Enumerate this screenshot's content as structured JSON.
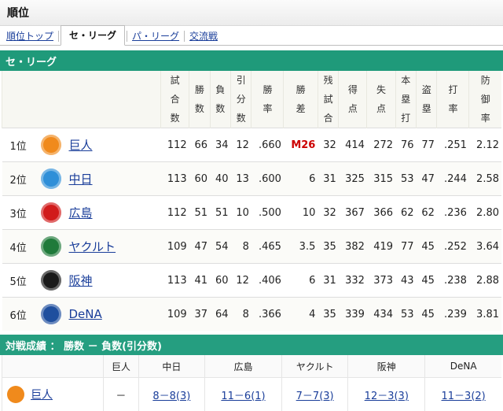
{
  "page_title": "順位",
  "tabs": [
    "順位トップ",
    "セ・リーグ",
    "パ・リーグ",
    "交流戦"
  ],
  "section_title": "セ・リーグ",
  "columns": [
    "試合数",
    "勝数",
    "負数",
    "引分数",
    "勝率",
    "勝差",
    "残試合",
    "得点",
    "失点",
    "本塁打",
    "盗塁",
    "打率",
    "防御率"
  ],
  "teams": [
    {
      "rank": "1位",
      "name": "巨人",
      "games": "112",
      "w": "66",
      "l": "34",
      "d": "12",
      "pct": ".660",
      "gb": "M26",
      "rem": "32",
      "rs": "414",
      "ra": "272",
      "hr": "76",
      "sb": "77",
      "avg": ".251",
      "era": "2.12",
      "logo": "giants-icon",
      "color": "#f08a1c"
    },
    {
      "rank": "2位",
      "name": "中日",
      "games": "113",
      "w": "60",
      "l": "40",
      "d": "13",
      "pct": ".600",
      "gb": "6",
      "rem": "31",
      "rs": "325",
      "ra": "315",
      "hr": "53",
      "sb": "47",
      "avg": ".244",
      "era": "2.58",
      "logo": "dragons-icon",
      "color": "#2f8fd8"
    },
    {
      "rank": "3位",
      "name": "広島",
      "games": "112",
      "w": "51",
      "l": "51",
      "d": "10",
      "pct": ".500",
      "gb": "10",
      "rem": "32",
      "rs": "367",
      "ra": "366",
      "hr": "62",
      "sb": "62",
      "avg": ".236",
      "era": "2.80",
      "logo": "carp-icon",
      "color": "#d11b1b"
    },
    {
      "rank": "4位",
      "name": "ヤクルト",
      "games": "109",
      "w": "47",
      "l": "54",
      "d": "8",
      "pct": ".465",
      "gb": "3.5",
      "rem": "35",
      "rs": "382",
      "ra": "419",
      "hr": "77",
      "sb": "45",
      "avg": ".252",
      "era": "3.64",
      "logo": "swallows-icon",
      "color": "#1f7a3a"
    },
    {
      "rank": "5位",
      "name": "阪神",
      "games": "113",
      "w": "41",
      "l": "60",
      "d": "12",
      "pct": ".406",
      "gb": "6",
      "rem": "31",
      "rs": "332",
      "ra": "373",
      "hr": "43",
      "sb": "45",
      "avg": ".238",
      "era": "2.88",
      "logo": "tigers-icon",
      "color": "#1a1a1a"
    },
    {
      "rank": "6位",
      "name": "DeNA",
      "games": "109",
      "w": "37",
      "l": "64",
      "d": "8",
      "pct": ".366",
      "gb": "4",
      "rem": "35",
      "rs": "339",
      "ra": "434",
      "hr": "53",
      "sb": "45",
      "avg": ".239",
      "era": "3.81",
      "logo": "baystars-icon",
      "color": "#1f4f9e"
    }
  ],
  "vs_title": "対戦成績 ： 勝数 － 負数(引分数)",
  "vs_columns": [
    "巨人",
    "中日",
    "広島",
    "ヤクルト",
    "阪神",
    "DeNA"
  ],
  "vs_rows": [
    {
      "team": "巨人",
      "cells": [
        "－",
        "8－8(3)",
        "11－6(1)",
        "7－7(3)",
        "12－3(3)",
        "11－3(2)"
      ]
    }
  ]
}
